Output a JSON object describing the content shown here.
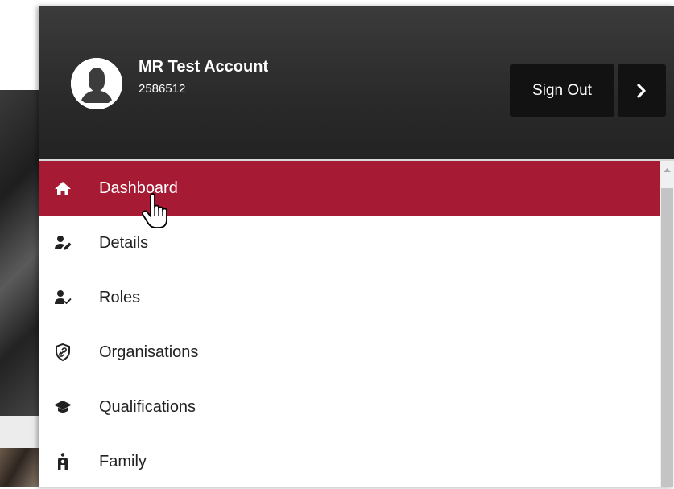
{
  "account": {
    "name": "MR Test Account",
    "id": "2586512"
  },
  "header": {
    "signout_label": "Sign Out",
    "next_icon": "chevron-right-icon"
  },
  "nav": {
    "active_index": 0,
    "items": [
      {
        "label": "Dashboard",
        "icon": "home-icon"
      },
      {
        "label": "Details",
        "icon": "user-edit-icon"
      },
      {
        "label": "Roles",
        "icon": "user-check-icon"
      },
      {
        "label": "Organisations",
        "icon": "shield-link-icon"
      },
      {
        "label": "Qualifications",
        "icon": "graduation-cap-icon"
      },
      {
        "label": "Family",
        "icon": "family-icon"
      }
    ]
  },
  "colors": {
    "header_bg": "#2a2a2a",
    "active_item": "#a61a33",
    "button_bg": "#121212"
  }
}
